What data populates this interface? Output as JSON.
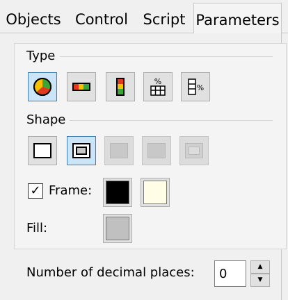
{
  "tabs": [
    {
      "label": "Objects"
    },
    {
      "label": "Control"
    },
    {
      "label": "Script"
    },
    {
      "label": "Parameters",
      "active": true
    }
  ],
  "type_section": {
    "label": "Type",
    "buttons": [
      {
        "name": "pie-chart",
        "icon": "pie-chart-icon",
        "selected": true
      },
      {
        "name": "horizontal-bar",
        "icon": "horizontal-bar-gauge-icon"
      },
      {
        "name": "vertical-bar",
        "icon": "vertical-bar-gauge-icon"
      },
      {
        "name": "percent-stack",
        "icon": "percent-stack-icon"
      },
      {
        "name": "percent-table",
        "icon": "percent-table-icon"
      }
    ]
  },
  "shape_section": {
    "label": "Shape",
    "buttons": [
      {
        "name": "plain-frame",
        "selected": false,
        "enabled": true
      },
      {
        "name": "double-frame",
        "selected": true,
        "enabled": true
      },
      {
        "name": "sunken-frame",
        "enabled": false
      },
      {
        "name": "raised-frame",
        "enabled": false
      },
      {
        "name": "inset-frame",
        "enabled": false
      }
    ]
  },
  "frame": {
    "checked": true,
    "check_glyph": "✓",
    "label": "Frame:",
    "color1": "#000000",
    "color2": "#fffde6"
  },
  "fill": {
    "label": "Fill:",
    "color": "#c0c0c0"
  },
  "decimal": {
    "label": "Number of decimal places:",
    "value": "0",
    "up_glyph": "▲",
    "down_glyph": "▼"
  }
}
